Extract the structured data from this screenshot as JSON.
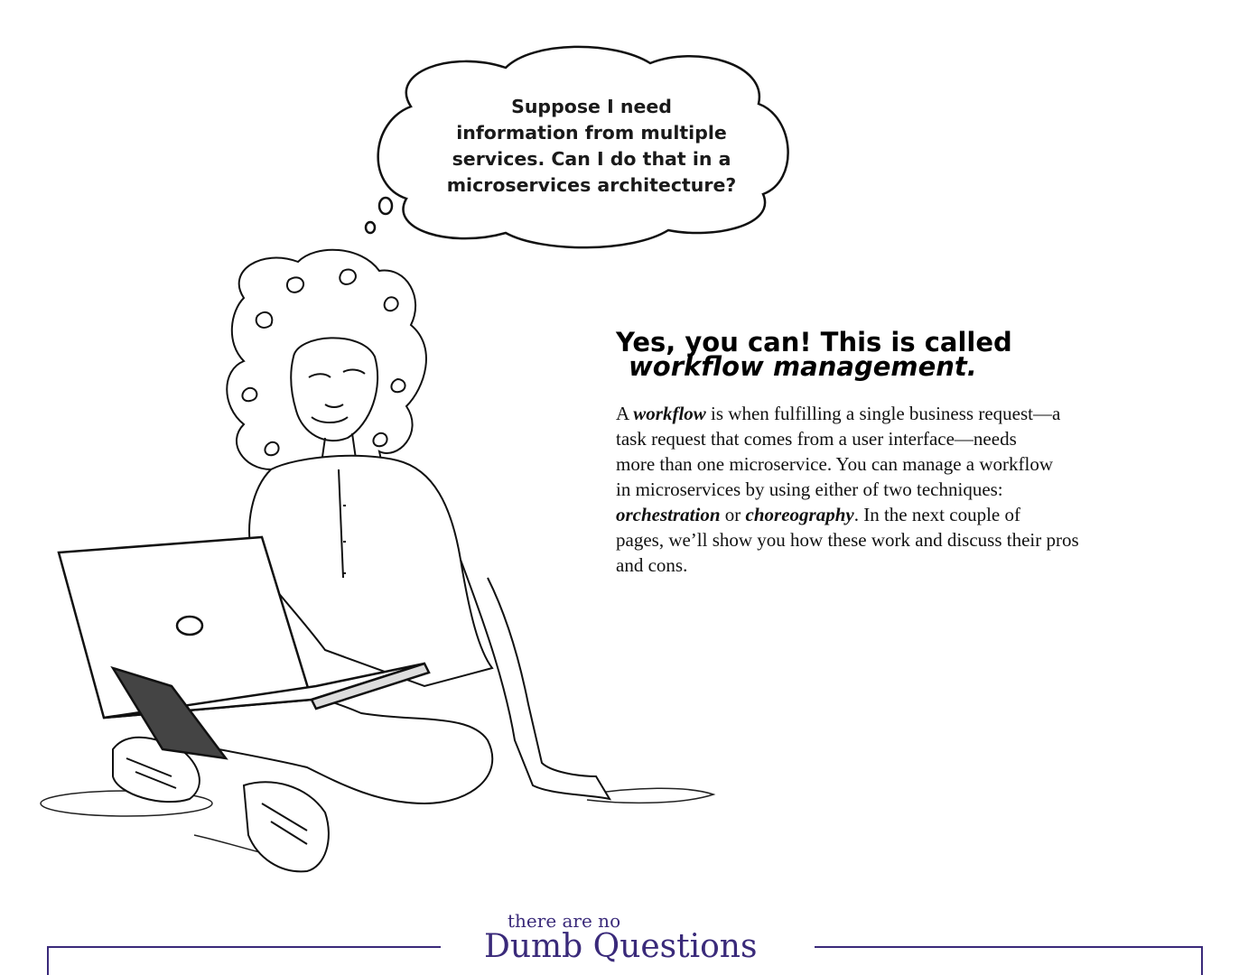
{
  "bubble": {
    "lines": [
      "Suppose I need",
      "information from multiple",
      "services. Can I do that in a",
      "microservices architecture?"
    ]
  },
  "heading": {
    "line1": "Yes, you can! This is called",
    "line2": "workflow management."
  },
  "body": {
    "l1_pre": "A ",
    "l1_em": "workflow",
    "l1_post": " is when fulfilling a single business request—a",
    "l2": "task request that comes from a user interface—needs",
    "l3": "more than one microservice. You can manage a workflow",
    "l4": "in microservices by using either of two techniques:",
    "l5_em1": "orchestration",
    "l5_mid": " or ",
    "l5_em2": "choreography",
    "l5_post": ". In the next couple of",
    "l6": "pages, we’ll show you how these work and discuss their pros",
    "l7": "and cons."
  },
  "banner": {
    "small": "there are no",
    "big": "Dumb Questions"
  },
  "colors": {
    "banner": "#3a2a7a",
    "text": "#111111"
  }
}
